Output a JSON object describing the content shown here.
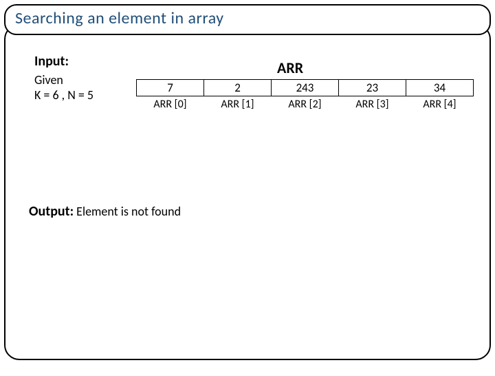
{
  "title": "Searching an element in array",
  "input": {
    "label": "Input:",
    "given_word": "Given",
    "params": "K = 6 , N = 5"
  },
  "array": {
    "name": "ARR",
    "values": [
      "7",
      "2",
      "243",
      "23",
      "34"
    ],
    "indices": [
      "ARR [0]",
      "ARR [1]",
      "ARR [2]",
      "ARR [3]",
      "ARR [4]"
    ]
  },
  "output": {
    "label": "Output:",
    "text": " Element is not found"
  }
}
